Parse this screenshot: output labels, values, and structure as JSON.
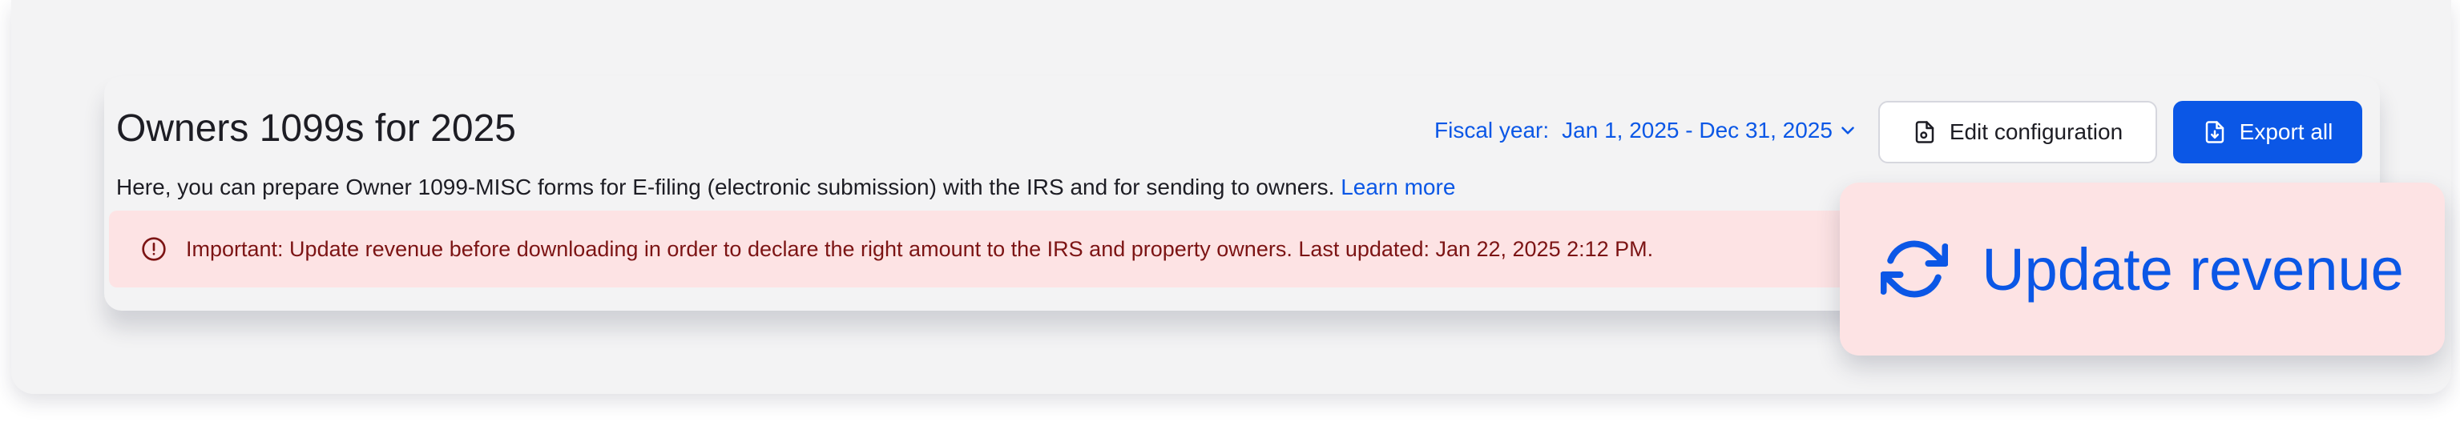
{
  "header": {
    "title": "Owners 1099s for 2025",
    "description": "Here, you can prepare Owner 1099-MISC forms for E-filing (electronic submission) with the IRS and for sending to owners.",
    "learn_more": "Learn more"
  },
  "fiscal_year": {
    "label": "Fiscal year:",
    "value": "Jan 1, 2025 - Dec 31, 2025",
    "icon": "chevron-down-icon"
  },
  "actions": {
    "edit_configuration": "Edit configuration",
    "edit_icon": "file-settings-icon",
    "export_all": "Export all",
    "export_icon": "file-download-icon"
  },
  "alert": {
    "icon": "alert-circle-icon",
    "message": "Important: Update revenue before downloading in order to declare the right amount to the IRS and property owners. Last updated: Jan 22, 2025 2:12 PM."
  },
  "update_revenue": {
    "label": "Update revenue",
    "icon": "refresh-icon"
  },
  "colors": {
    "primary": "#0b57e6",
    "alert_background": "#fde3e4",
    "alert_text": "#7c1414",
    "title_text": "#1d1d24",
    "surface": "#f3f3f4"
  }
}
